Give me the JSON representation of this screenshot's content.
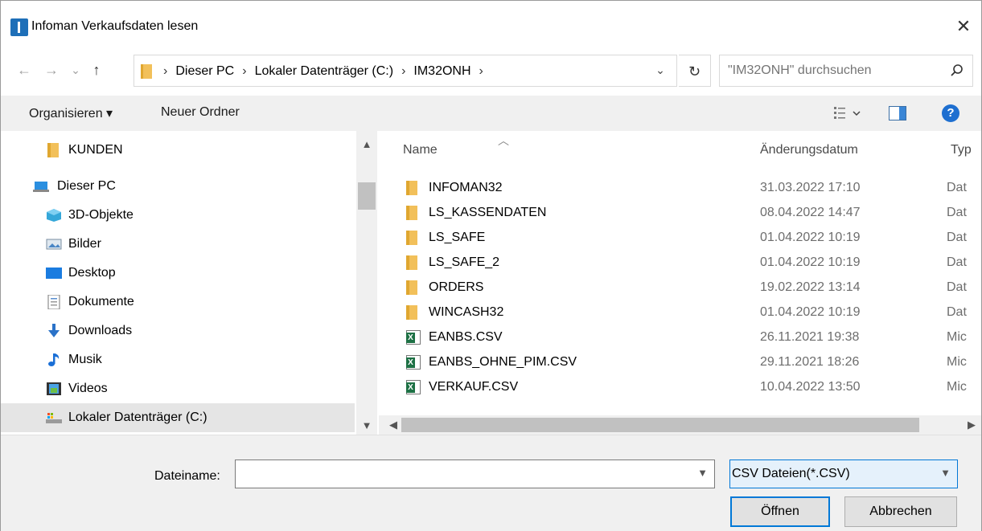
{
  "window": {
    "title": "Infoman Verkaufsdaten lesen",
    "close_glyph": "✕"
  },
  "nav": {
    "back": "←",
    "forward": "→",
    "recent": "⌄",
    "up": "↑",
    "breadcrumbs": [
      "Dieser PC",
      "Lokaler Datenträger (C:)",
      "IM32ONH"
    ],
    "separator": "›",
    "refresh": "↻",
    "search_placeholder": "\"IM32ONH\" durchsuchen"
  },
  "toolbar": {
    "organize": "Organisieren ▾",
    "new_folder": "Neuer Ordner"
  },
  "tree": [
    {
      "label": "KUNDEN",
      "icon": "folder-icon"
    },
    {
      "label": "Dieser PC",
      "icon": "computer-icon"
    },
    {
      "label": "3D-Objekte",
      "icon": "3d-objects-icon"
    },
    {
      "label": "Bilder",
      "icon": "pictures-icon"
    },
    {
      "label": "Desktop",
      "icon": "desktop-icon"
    },
    {
      "label": "Dokumente",
      "icon": "documents-icon"
    },
    {
      "label": "Downloads",
      "icon": "downloads-icon"
    },
    {
      "label": "Musik",
      "icon": "music-icon"
    },
    {
      "label": "Videos",
      "icon": "videos-icon"
    },
    {
      "label": "Lokaler Datenträger (C:)",
      "icon": "drive-icon"
    }
  ],
  "columns": {
    "name": "Name",
    "date": "Änderungsdatum",
    "type": "Typ"
  },
  "files": [
    {
      "name": "INFOMAN32",
      "date": "31.03.2022 17:10",
      "type": "Dat",
      "kind": "folder"
    },
    {
      "name": "LS_KASSENDATEN",
      "date": "08.04.2022 14:47",
      "type": "Dat",
      "kind": "folder"
    },
    {
      "name": "LS_SAFE",
      "date": "01.04.2022 10:19",
      "type": "Dat",
      "kind": "folder"
    },
    {
      "name": "LS_SAFE_2",
      "date": "01.04.2022 10:19",
      "type": "Dat",
      "kind": "folder"
    },
    {
      "name": "ORDERS",
      "date": "19.02.2022 13:14",
      "type": "Dat",
      "kind": "folder"
    },
    {
      "name": "WINCASH32",
      "date": "01.04.2022 10:19",
      "type": "Dat",
      "kind": "folder"
    },
    {
      "name": "EANBS.CSV",
      "date": "26.11.2021 19:38",
      "type": "Mic",
      "kind": "csv"
    },
    {
      "name": "EANBS_OHNE_PIM.CSV",
      "date": "29.11.2021 18:26",
      "type": "Mic",
      "kind": "csv"
    },
    {
      "name": "VERKAUF.CSV",
      "date": "10.04.2022 13:50",
      "type": "Mic",
      "kind": "csv"
    }
  ],
  "footer": {
    "filename_label": "Dateiname:",
    "filename_value": "",
    "filter_value": "CSV Dateien(*.CSV)",
    "open_label": "Öffnen",
    "cancel_label": "Abbrechen"
  }
}
